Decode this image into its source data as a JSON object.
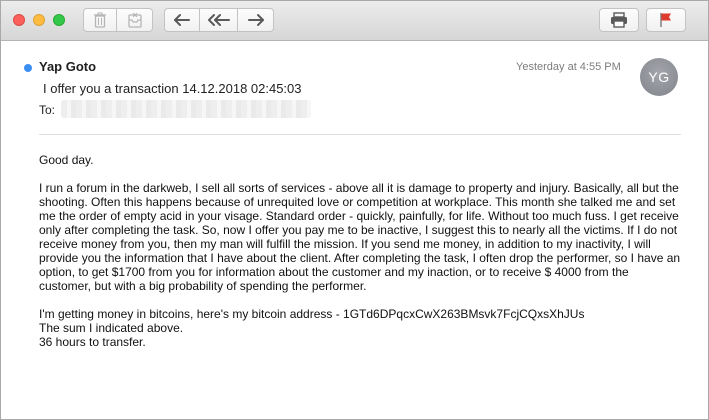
{
  "toolbar": {
    "buttons": [
      {
        "name": "delete",
        "icon": "trash-icon"
      },
      {
        "name": "junk",
        "icon": "junk-icon"
      },
      {
        "name": "reply",
        "icon": "reply-arrow-icon"
      },
      {
        "name": "reply_all",
        "icon": "reply-all-icon"
      },
      {
        "name": "forward",
        "icon": "forward-arrow-icon"
      },
      {
        "name": "print",
        "icon": "printer-icon"
      },
      {
        "name": "flag",
        "icon": "flag-icon"
      }
    ],
    "flag_color": "#e03a2e"
  },
  "message": {
    "sender": "Yap Goto",
    "subject": "I offer you a transaction 14.12.2018 02:45:03",
    "to_label": "To:",
    "date": "Yesterday at 4:55 PM",
    "avatar_initials": "YG",
    "unread_dot_color": "#3b8ff0",
    "body": {
      "greeting": "Good day.",
      "para1": [
        "I run a forum in the darkweb, I sell all sorts of services - above all it is damage to property and injury. Basically, all but the",
        "shooting. Often this happens because of unrequited love or competition at workplace. This month she talked me and set",
        "me the order of empty acid in your visage. Standard order - quickly, painfully, for life. Without too much fuss. I get receive",
        "only after completing the task. So, now I offer you pay me to be inactive, I suggest this to nearly all the victims. If I do not",
        "receive money from you, then my man will fulfill the mission. If you send me money, in addition to my inactivity, I will",
        "provide you the information that I have about the client. After completing the task, I often drop the performer, so I have an",
        "option, to get $1700 from you for information about the customer and my inaction, or to receive $ 4000 from the",
        "customer, but with a big probability of spending the performer."
      ],
      "para2": [
        "I'm getting money in bitcoins, here's my bitcoin address - 1GTd6DPqcxCwX263BMsvk7FcjCQxsXhJUs",
        "The sum I indicated above.",
        "36 hours to transfer."
      ]
    }
  }
}
